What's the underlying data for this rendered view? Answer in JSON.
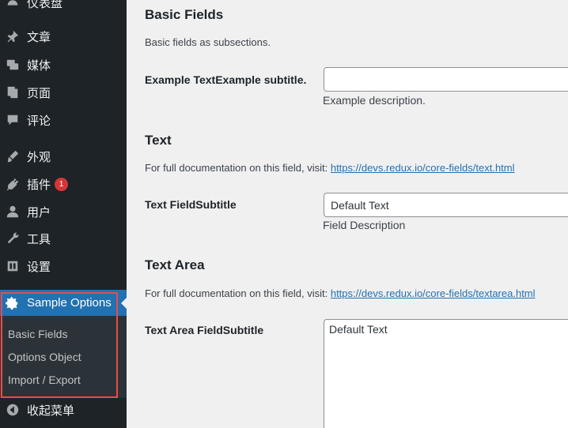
{
  "sidebar": {
    "partial_top_label": "仪表盘",
    "items": [
      {
        "label": "文章",
        "icon": "pin-icon"
      },
      {
        "label": "媒体",
        "icon": "media-icon"
      },
      {
        "label": "页面",
        "icon": "pages-icon"
      },
      {
        "label": "评论",
        "icon": "comments-icon"
      },
      {
        "label": "外观",
        "icon": "appearance-icon"
      },
      {
        "label": "插件",
        "icon": "plugins-icon",
        "badge": "1"
      },
      {
        "label": "用户",
        "icon": "users-icon"
      },
      {
        "label": "工具",
        "icon": "tools-icon"
      },
      {
        "label": "设置",
        "icon": "settings-icon"
      }
    ],
    "current": {
      "label": "Sample Options",
      "icon": "gear-icon"
    },
    "submenu": [
      "Basic Fields",
      "Options Object",
      "Import / Export"
    ],
    "collapse_label": "收起菜单",
    "accent_color": "#2271b1",
    "highlight_color": "#e74c4c"
  },
  "main": {
    "basic": {
      "title": "Basic Fields",
      "description": "Basic fields as subsections.",
      "field_label": "Example TextExample subtitle.",
      "field_value": "",
      "field_desc": "Example description."
    },
    "text": {
      "title": "Text",
      "doc_prefix": "For full documentation on this field, visit: ",
      "doc_link": "https://devs.redux.io/core-fields/text.html",
      "field_label": "Text FieldSubtitle",
      "field_value": "Default Text",
      "field_desc": "Field Description"
    },
    "textarea": {
      "title": "Text Area",
      "doc_prefix": "For full documentation on this field, visit: ",
      "doc_link": "https://devs.redux.io/core-fields/textarea.html",
      "field_label": "Text Area FieldSubtitle",
      "field_value": "Default Text"
    }
  }
}
